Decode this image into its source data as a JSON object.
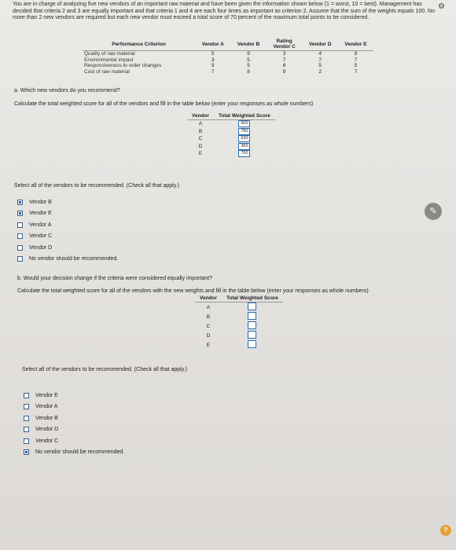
{
  "intro": "You are in charge of analyzing five new vendors of an important raw material and have been given the information shown below (1 = worst, 10 = best). Management has decided that criteria 2 and 3 are equally important and that criteria 1 and 4 are each four times as important as criterion 2. Assume that the sum of the weights equals 100. No more than 2 new vendors are required but each new vendor must exceed a total score of 70 percent of the maximum total points to be considered.",
  "criteria_table": {
    "headers": [
      "Performance Criterion",
      "Vendor A",
      "Vendor B",
      "Rating\nVendor C",
      "Vendor D",
      "Vendor E"
    ],
    "rows": [
      {
        "criterion": "Quality of raw material",
        "values": [
          "5",
          "9",
          "3",
          "4",
          "9"
        ]
      },
      {
        "criterion": "Environmental impact",
        "values": [
          "3",
          "5",
          "7",
          "7",
          "7"
        ]
      },
      {
        "criterion": "Responsiveness to order changes",
        "values": [
          "9",
          "5",
          "6",
          "5",
          "5"
        ]
      },
      {
        "criterion": "Cost of raw material",
        "values": [
          "7",
          "8",
          "9",
          "2",
          "7"
        ]
      }
    ]
  },
  "part_a": {
    "question": "a. Which new vendors do you recommend?",
    "instruction": "Calculate the total weighted score for all of the vendors and fill in the table below (enter your responses as whole numbers)",
    "table_headers": [
      "Vendor",
      "Total Weighted Score"
    ],
    "rows": [
      {
        "vendor": "A",
        "score": "600"
      },
      {
        "vendor": "B",
        "score": "780"
      },
      {
        "vendor": "C",
        "score": "630"
      },
      {
        "vendor": "D",
        "score": "360"
      },
      {
        "vendor": "E",
        "score": "760"
      }
    ],
    "select_prompt": "Select all of the vendors to be recommended. (Check all that apply.)",
    "options": [
      {
        "label": "Vendor B",
        "checked": true
      },
      {
        "label": "Vendor E",
        "checked": true
      },
      {
        "label": "Vendor A",
        "checked": false
      },
      {
        "label": "Vendor C",
        "checked": false
      },
      {
        "label": "Vendor D",
        "checked": false
      },
      {
        "label": "No vendor should be recommended.",
        "checked": false
      }
    ]
  },
  "part_b": {
    "question": "b. Would your decision change if the criteria were considered equally important?",
    "instruction": "Calculate the total weighted score for all of the vendors with the new weights and fill in the table below (enter your responses as whole numbers)",
    "table_headers": [
      "Vendor",
      "Total Weighted Score"
    ],
    "rows": [
      {
        "vendor": "A",
        "score": ""
      },
      {
        "vendor": "B",
        "score": ""
      },
      {
        "vendor": "C",
        "score": ""
      },
      {
        "vendor": "D",
        "score": ""
      },
      {
        "vendor": "E",
        "score": ""
      }
    ],
    "select_prompt": "Select all of the vendors to be recommended. (Check all that apply.)",
    "options": [
      {
        "label": "Vendor E",
        "checked": false
      },
      {
        "label": "Vendor A",
        "checked": false
      },
      {
        "label": "Vendor B",
        "checked": false
      },
      {
        "label": "Vendor D",
        "checked": false
      },
      {
        "label": "Vendor C",
        "checked": false
      },
      {
        "label": "No vendor should be recommended.",
        "checked": true
      }
    ]
  },
  "help_label": "?",
  "colors": {
    "checkbox_border": "#3a5f8a",
    "input_border": "#2b6cb0",
    "help_badge": "#e2a23a"
  }
}
